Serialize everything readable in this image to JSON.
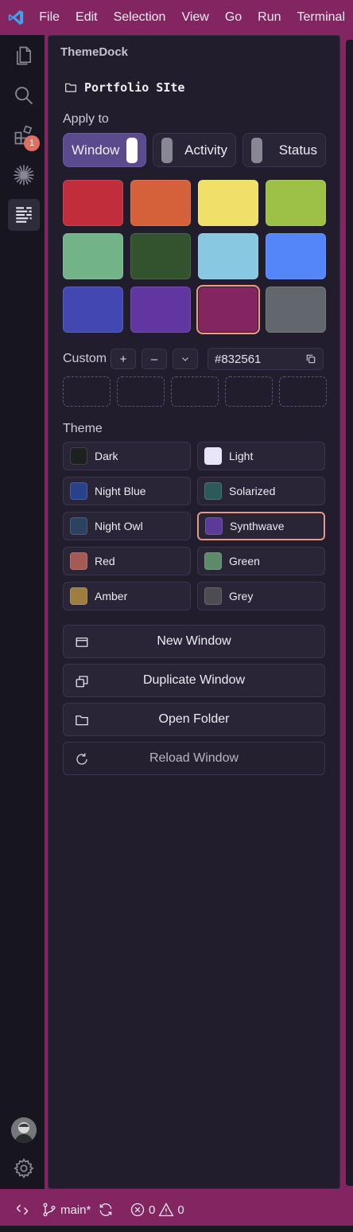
{
  "menubar": {
    "items": [
      "File",
      "Edit",
      "Selection",
      "View",
      "Go",
      "Run",
      "Terminal"
    ]
  },
  "activitybar": {
    "icons": [
      "explorer-icon",
      "search-icon",
      "extensions-icon",
      "sparkle-icon",
      "themedock-icon"
    ],
    "extensions_badge": "1",
    "bottom_icons": [
      "account-avatar",
      "gear-icon"
    ]
  },
  "panel": {
    "title": "ThemeDock",
    "folder_name": "Portfolio SIte",
    "apply_to_label": "Apply to",
    "apply_targets": [
      {
        "label": "Window",
        "on": true
      },
      {
        "label": "Activity",
        "on": false
      },
      {
        "label": "Status",
        "on": false
      }
    ],
    "swatches": [
      "#c12d3a",
      "#d5613a",
      "#f0e06a",
      "#9dc046",
      "#72b487",
      "#33532f",
      "#88c8e0",
      "#5486f9",
      "#4347b2",
      "#6236a1",
      "#832561",
      "#62666d"
    ],
    "selected_swatch": "#832561",
    "custom_label": "Custom",
    "custom_plus": "+",
    "custom_minus": "–",
    "hex_hash": "#",
    "hex_value": "832561",
    "theme_label": "Theme",
    "themes": [
      {
        "label": "Dark",
        "chip": "#1d2120"
      },
      {
        "label": "Light",
        "chip": "#e6e6f8"
      },
      {
        "label": "Night Blue",
        "chip": "#27428a"
      },
      {
        "label": "Solarized",
        "chip": "#2c5a5a"
      },
      {
        "label": "Night Owl",
        "chip": "#2c4260"
      },
      {
        "label": "Synthwave",
        "chip": "#5b3a98"
      },
      {
        "label": "Red",
        "chip": "#a55a55"
      },
      {
        "label": "Green",
        "chip": "#5d8a68"
      },
      {
        "label": "Amber",
        "chip": "#9e7d40"
      },
      {
        "label": "Grey",
        "chip": "#4c4c52"
      }
    ],
    "selected_theme": "Synthwave",
    "actions": [
      {
        "label": "New Window",
        "icon": "window-icon"
      },
      {
        "label": "Duplicate Window",
        "icon": "duplicate-icon"
      },
      {
        "label": "Open Folder",
        "icon": "folder-icon"
      },
      {
        "label": "Reload Window",
        "icon": "reload-icon"
      }
    ]
  },
  "statusbar": {
    "branch": "main*",
    "errors": "0",
    "warnings": "0"
  },
  "colors": {
    "accent": "#832561",
    "panel_bg": "#211d2d",
    "activitybar_bg": "#17151f",
    "selection_outline": "#e49a88"
  }
}
